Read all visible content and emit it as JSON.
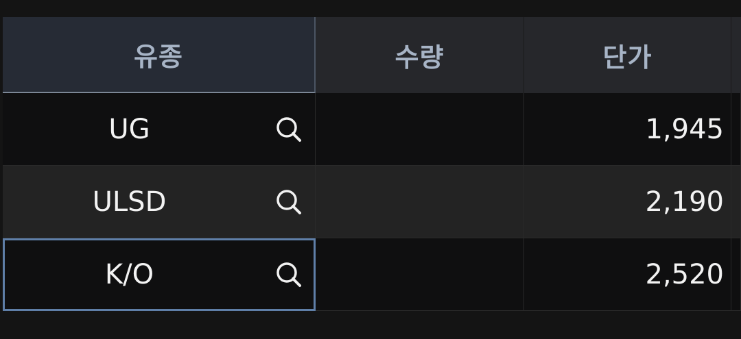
{
  "table": {
    "headers": {
      "product": "유종",
      "quantity": "수량",
      "unit_price": "단가"
    },
    "rows": [
      {
        "product": "UG",
        "quantity": "",
        "unit_price": "1,945"
      },
      {
        "product": "ULSD",
        "quantity": "",
        "unit_price": "2,190"
      },
      {
        "product": "K/O",
        "quantity": "",
        "unit_price": "2,520"
      }
    ],
    "selected_row_index": 2,
    "search_icon_name": "search-icon"
  },
  "colors": {
    "background": "#141414",
    "header_background": "#26272b",
    "header_text": "#a7b4c6",
    "selected_border": "#5f7fa8",
    "cell_text": "#f3f3f3"
  }
}
